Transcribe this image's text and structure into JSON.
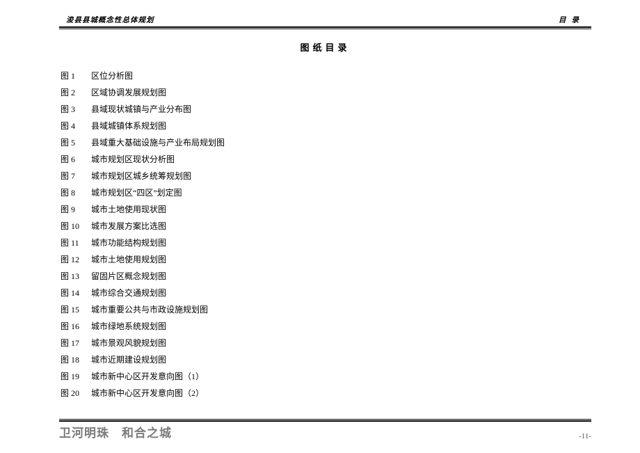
{
  "header": {
    "left": "浚县县城概念性总体规划",
    "right": "目录"
  },
  "title": "图纸目录",
  "items": [
    {
      "label": "图 1",
      "title": "区位分析图"
    },
    {
      "label": "图 2",
      "title": "区域协调发展规划图"
    },
    {
      "label": "图 3",
      "title": "县域现状城镇与产业分布图"
    },
    {
      "label": "图 4",
      "title": "县域城镇体系规划图"
    },
    {
      "label": "图 5",
      "title": "县域重大基础设施与产业布局规划图"
    },
    {
      "label": "图 6",
      "title": "城市规划区现状分析图"
    },
    {
      "label": "图 7",
      "title": "城市规划区城乡统筹规划图"
    },
    {
      "label": "图 8",
      "title": "城市规划区“四区”划定图"
    },
    {
      "label": "图 9",
      "title": "城市土地使用现状图"
    },
    {
      "label": "图 10",
      "title": "城市发展方案比选图"
    },
    {
      "label": "图 11",
      "title": "城市功能结构规划图"
    },
    {
      "label": "图 12",
      "title": "城市土地使用规划图"
    },
    {
      "label": "图 13",
      "title": "留固片区概念规划图"
    },
    {
      "label": "图 14",
      "title": "城市综合交通规划图"
    },
    {
      "label": "图 15",
      "title": "城市重要公共与市政设施规划图"
    },
    {
      "label": "图 16",
      "title": "城市绿地系统规划图"
    },
    {
      "label": "图 17",
      "title": "城市景观风貌规划图"
    },
    {
      "label": "图 18",
      "title": "城市近期建设规划图"
    },
    {
      "label": "图 19",
      "title": "城市新中心区开发意向图（1）"
    },
    {
      "label": "图 20",
      "title": "城市新中心区开发意向图（2）"
    }
  ],
  "footer": {
    "left_a": "卫河明珠",
    "left_b": "和合之城",
    "page": "-11-"
  }
}
